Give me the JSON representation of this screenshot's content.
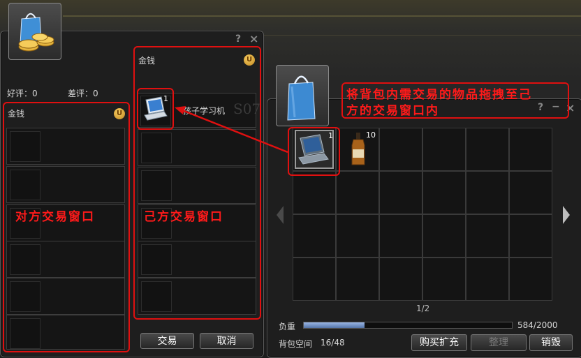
{
  "colors": {
    "annotation_red": "#e01010",
    "coin_gold": "#e3ad3c",
    "weight_bar": "#6e8fc4"
  },
  "window_controls": {
    "help": "?",
    "close": "×",
    "minimize": "−"
  },
  "opponent": {
    "good_rating_label": "好评：",
    "good_rating_value": "0",
    "bad_rating_label": "差评：",
    "bad_rating_value": "0",
    "money_label": "金钱",
    "coin_icon": "U",
    "annotation": "对方交易窗口"
  },
  "self": {
    "money_label": "金钱",
    "coin_icon": "U",
    "item_name": "孩子学习机",
    "item_count": "1",
    "annotation": "己方交易窗口",
    "trade_button": "交易",
    "cancel_button": "取消"
  },
  "bag": {
    "annotation_line1": "将背包内需交易的物品拖拽至己",
    "annotation_line2": "方的交易窗口内",
    "items": [
      {
        "name": "laptop",
        "count": "1"
      },
      {
        "name": "whisky-bottle",
        "count": "10"
      }
    ],
    "page": "1/2",
    "weight_label": "负重",
    "weight_value": "584/2000",
    "weight_fraction": 0.292,
    "space_label": "背包空间",
    "space_value": "16/48",
    "buy_expand_button": "购买扩充",
    "sort_button": "整理",
    "destroy_button": "销毁",
    "watermark": "S07"
  }
}
